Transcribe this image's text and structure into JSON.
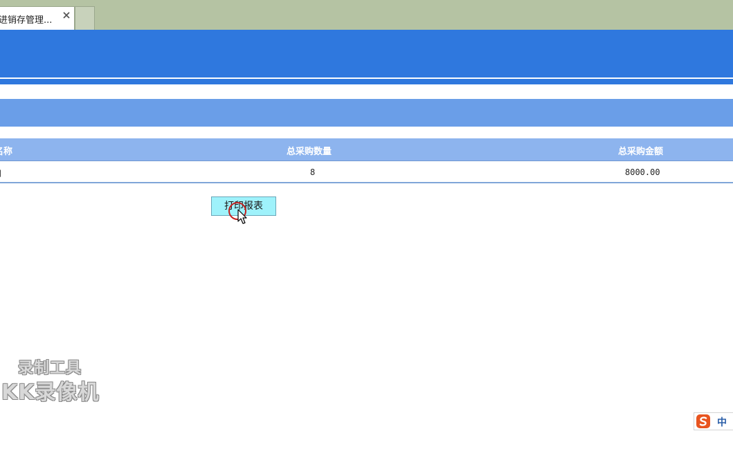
{
  "browser": {
    "tab_title": "进销存管理...",
    "tab_close_icon": "close-icon"
  },
  "table": {
    "headers": {
      "name": "名称",
      "qty": "总采购数量",
      "amount": "总采购金额"
    },
    "rows": [
      {
        "name": "月",
        "qty": "8",
        "amount": "8000.00"
      }
    ]
  },
  "actions": {
    "print_label": "打印报表"
  },
  "watermark": {
    "line1": "录制工具",
    "line2": "KK录像机"
  },
  "ime": {
    "mode": "中",
    "logo_icon": "sogou-s-icon"
  },
  "colors": {
    "header_blue": "#2f78de",
    "section_blue": "#6a9ee8",
    "table_head": "#8db4ee",
    "button_cyan": "#9ff2fb",
    "tabstrip": "#b5c3a3"
  }
}
